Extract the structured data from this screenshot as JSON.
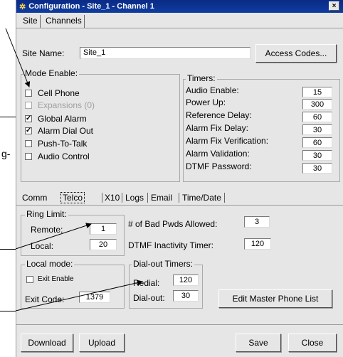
{
  "window": {
    "title": "Configuration - Site_1 - Channel 1",
    "close": "×"
  },
  "top_tabs": [
    "Site",
    "Channels"
  ],
  "site_name": {
    "label": "Site Name:",
    "value": "Site_1"
  },
  "access_codes_button": "Access Codes...",
  "mode_enable": {
    "label": "Mode Enable:",
    "items": [
      {
        "label": "Cell Phone",
        "checked": false,
        "disabled": false
      },
      {
        "label": "Expansions (0)",
        "checked": false,
        "disabled": true
      },
      {
        "label": "Global Alarm",
        "checked": true,
        "disabled": false
      },
      {
        "label": "Alarm Dial Out",
        "checked": true,
        "disabled": false
      },
      {
        "label": "Push-To-Talk",
        "checked": false,
        "disabled": false
      },
      {
        "label": "Audio Control",
        "checked": false,
        "disabled": false
      }
    ]
  },
  "timers": {
    "label": "Timers:",
    "rows": [
      {
        "label": "Audio Enable:",
        "value": "15"
      },
      {
        "label": "Power Up:",
        "value": "300"
      },
      {
        "label": "Reference Delay:",
        "value": "60"
      },
      {
        "label": "Alarm Fix Delay:",
        "value": "30"
      },
      {
        "label": "Alarm Fix Verification:",
        "value": "60"
      },
      {
        "label": "Alarm Validation:",
        "value": "30"
      },
      {
        "label": "DTMF Password:",
        "value": "30"
      }
    ]
  },
  "lower_tabs": [
    "Comm",
    "Telco",
    "X10",
    "Logs",
    "Email",
    "Time/Date"
  ],
  "ring_limit": {
    "label": "Ring Limit:",
    "remote_label": "Remote:",
    "remote_value": "1",
    "local_label": "Local:",
    "local_value": "20"
  },
  "bad_pwds": {
    "label": "# of Bad Pwds Allowed:",
    "value": "3"
  },
  "dtmf_inactivity": {
    "label": "DTMF Inactivity Timer:",
    "value": "120"
  },
  "local_mode": {
    "label": "Local mode:",
    "exit_enable": "Exit Enable",
    "exit_code_label": "Exit Code:",
    "exit_code_value": "1379"
  },
  "dialout_timers": {
    "label": "Dial-out Timers:",
    "redial_label": "Redial:",
    "redial_value": "120",
    "dialout_label": "Dial-out:",
    "dialout_value": "30"
  },
  "edit_phone_list_button": "Edit Master Phone List",
  "bottom_buttons": {
    "download": "Download",
    "upload": "Upload",
    "save": "Save",
    "close": "Close"
  },
  "side_text": "g-",
  "colors": {
    "titlebar": "#0f3c9f",
    "face": "#e6e6e6"
  }
}
